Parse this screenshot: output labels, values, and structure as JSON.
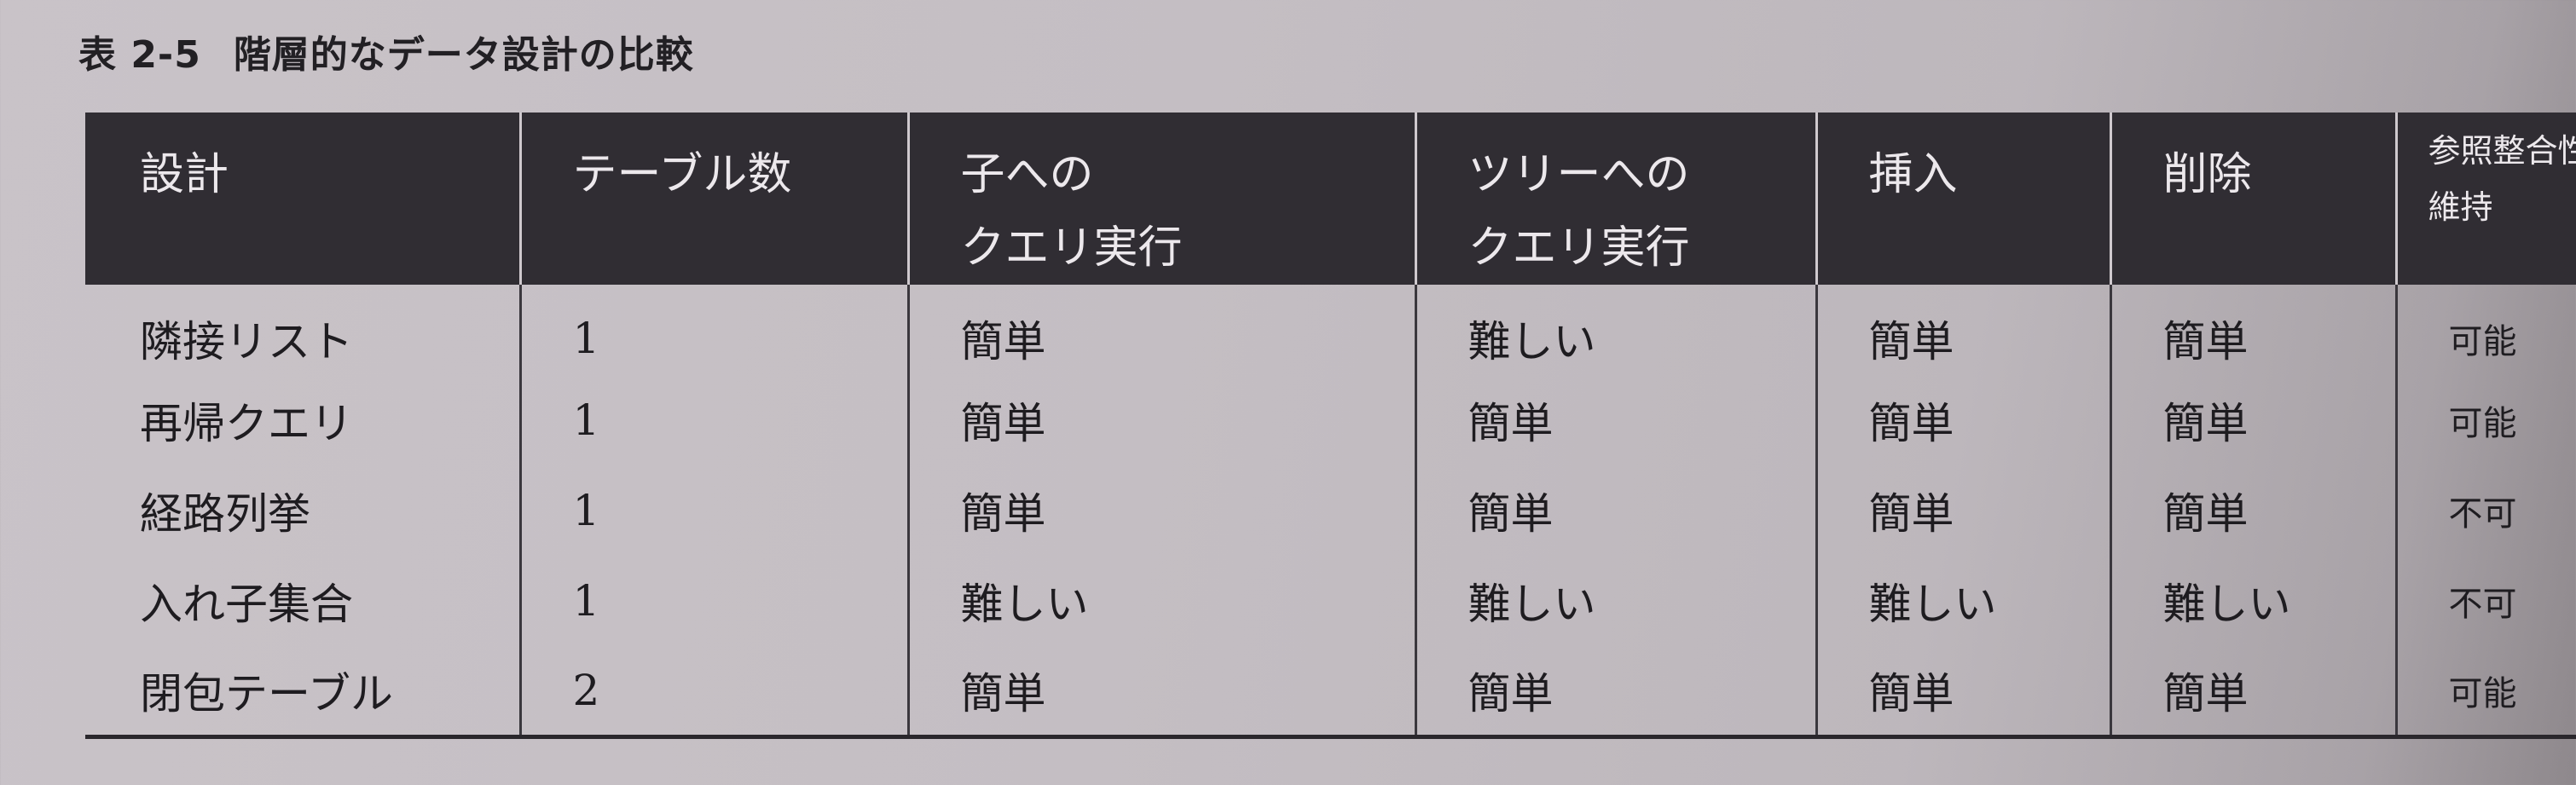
{
  "caption": {
    "number": "表 2-5",
    "title": "階層的なデータ設計の比較"
  },
  "table": {
    "headers": [
      {
        "line1": "設計",
        "line2": ""
      },
      {
        "line1": "テーブル数",
        "line2": ""
      },
      {
        "line1": "子への",
        "line2": "クエリ実行"
      },
      {
        "line1": "ツリーへの",
        "line2": "クエリ実行"
      },
      {
        "line1": "挿入",
        "line2": ""
      },
      {
        "line1": "削除",
        "line2": ""
      },
      {
        "line1": "参照整合性",
        "line2": "維持"
      }
    ],
    "rows": [
      [
        "隣接リスト",
        "1",
        "簡単",
        "難しい",
        "簡単",
        "簡単",
        "可能"
      ],
      [
        "再帰クエリ",
        "1",
        "簡単",
        "簡単",
        "簡単",
        "簡単",
        "可能"
      ],
      [
        "経路列挙",
        "1",
        "簡単",
        "簡単",
        "簡単",
        "簡単",
        "不可"
      ],
      [
        "入れ子集合",
        "1",
        "難しい",
        "難しい",
        "難しい",
        "難しい",
        "不可"
      ],
      [
        "閉包テーブル",
        "2",
        "簡単",
        "簡単",
        "簡単",
        "簡単",
        "可能"
      ]
    ]
  }
}
